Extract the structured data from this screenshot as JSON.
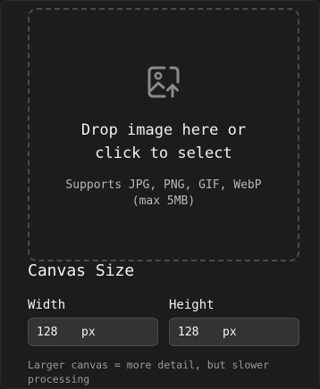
{
  "dropzone": {
    "icon": "image-upload-icon",
    "title": "Drop image here or click to select",
    "subtitle": "Supports JPG, PNG, GIF, WebP (max 5MB)"
  },
  "canvas": {
    "title": "Canvas Size",
    "width": {
      "label": "Width",
      "value": "128",
      "unit": "px"
    },
    "height": {
      "label": "Height",
      "value": "128",
      "unit": "px"
    },
    "hint": "Larger canvas = more detail, but slower processing"
  },
  "colors": {
    "background": "#1c1c1c",
    "input_bg": "#333333",
    "dashed_border": "#4a4a4a"
  }
}
